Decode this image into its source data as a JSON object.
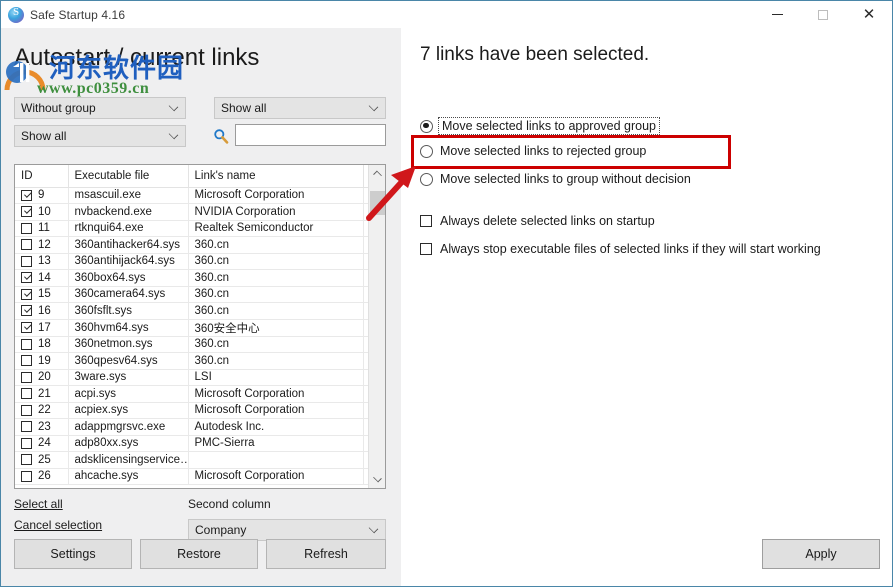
{
  "window": {
    "title": "Safe Startup 4.16",
    "icon": "app-circle-icon",
    "controls": {
      "minimize": "—",
      "maximize": "□",
      "close": "✕"
    },
    "border_color": "#4a86a8"
  },
  "watermark": {
    "chinese": "河东软件园",
    "url": "www.pc0359.cn",
    "logo": "arch-logo-icon",
    "chinese_color": "#1f5fbf",
    "url_color": "#3f8f3f"
  },
  "left": {
    "page_title": "Autostart / current links",
    "combo_group": {
      "value": "Without group"
    },
    "combo_filter": {
      "value": "Show all"
    },
    "combo_show": {
      "value": "Show all"
    },
    "search": {
      "value": "",
      "placeholder": "",
      "icon": "search-icon"
    },
    "table": {
      "headers": [
        "ID",
        "Executable file",
        "Link's name",
        ""
      ],
      "rows": [
        {
          "checked": true,
          "id": "9",
          "exe": "msascuil.exe",
          "link": "Microsoft Corporation"
        },
        {
          "checked": true,
          "id": "10",
          "exe": "nvbackend.exe",
          "link": "NVIDIA Corporation"
        },
        {
          "checked": false,
          "id": "11",
          "exe": "rtknqui64.exe",
          "link": "Realtek Semiconductor"
        },
        {
          "checked": false,
          "id": "12",
          "exe": "360antihacker64.sys",
          "link": "360.cn"
        },
        {
          "checked": false,
          "id": "13",
          "exe": "360antihijack64.sys",
          "link": "360.cn"
        },
        {
          "checked": true,
          "id": "14",
          "exe": "360box64.sys",
          "link": "360.cn"
        },
        {
          "checked": true,
          "id": "15",
          "exe": "360camera64.sys",
          "link": "360.cn"
        },
        {
          "checked": true,
          "id": "16",
          "exe": "360fsflt.sys",
          "link": "360.cn"
        },
        {
          "checked": true,
          "id": "17",
          "exe": "360hvm64.sys",
          "link": "360安全中心"
        },
        {
          "checked": false,
          "id": "18",
          "exe": "360netmon.sys",
          "link": "360.cn"
        },
        {
          "checked": false,
          "id": "19",
          "exe": "360qpesv64.sys",
          "link": "360.cn"
        },
        {
          "checked": false,
          "id": "20",
          "exe": "3ware.sys",
          "link": "LSI"
        },
        {
          "checked": false,
          "id": "21",
          "exe": "acpi.sys",
          "link": "Microsoft Corporation"
        },
        {
          "checked": false,
          "id": "22",
          "exe": "acpiex.sys",
          "link": "Microsoft Corporation"
        },
        {
          "checked": false,
          "id": "23",
          "exe": "adappmgrsvc.exe",
          "link": "Autodesk Inc."
        },
        {
          "checked": false,
          "id": "24",
          "exe": "adp80xx.sys",
          "link": "PMC-Sierra"
        },
        {
          "checked": false,
          "id": "25",
          "exe": "adsklicensingservice…",
          "link": ""
        },
        {
          "checked": false,
          "id": "26",
          "exe": "ahcache.sys",
          "link": "Microsoft Corporation"
        }
      ],
      "scroll_up_icon": "chevron-up-icon",
      "scroll_down_icon": "chevron-down-icon"
    },
    "select_all": "Select all",
    "cancel_selection": "Cancel selection",
    "second_column_label": "Second column",
    "combo_second": {
      "value": "Company"
    },
    "buttons": {
      "settings": "Settings",
      "restore": "Restore",
      "refresh": "Refresh"
    }
  },
  "right": {
    "heading": "7 links have been selected.",
    "selected_count": 7,
    "options": [
      {
        "label": "Move selected links to approved group",
        "type": "radio",
        "checked": true,
        "focused": true
      },
      {
        "label": "Move selected links to rejected group",
        "type": "radio",
        "checked": false,
        "focused": false
      },
      {
        "label": "Move selected links to group without decision",
        "type": "radio",
        "checked": false,
        "focused": false
      },
      {
        "label": "Always delete selected links on startup",
        "type": "checkbox",
        "checked": false,
        "focused": false
      },
      {
        "label": "Always stop executable files of selected links if they will start working",
        "type": "checkbox",
        "checked": false,
        "focused": false
      }
    ],
    "apply_button": "Apply"
  },
  "annotation": {
    "highlight_color": "#cc0000",
    "highlight_target": "Move selected links to group without decision",
    "arrow": "red-arrow-annotation"
  }
}
